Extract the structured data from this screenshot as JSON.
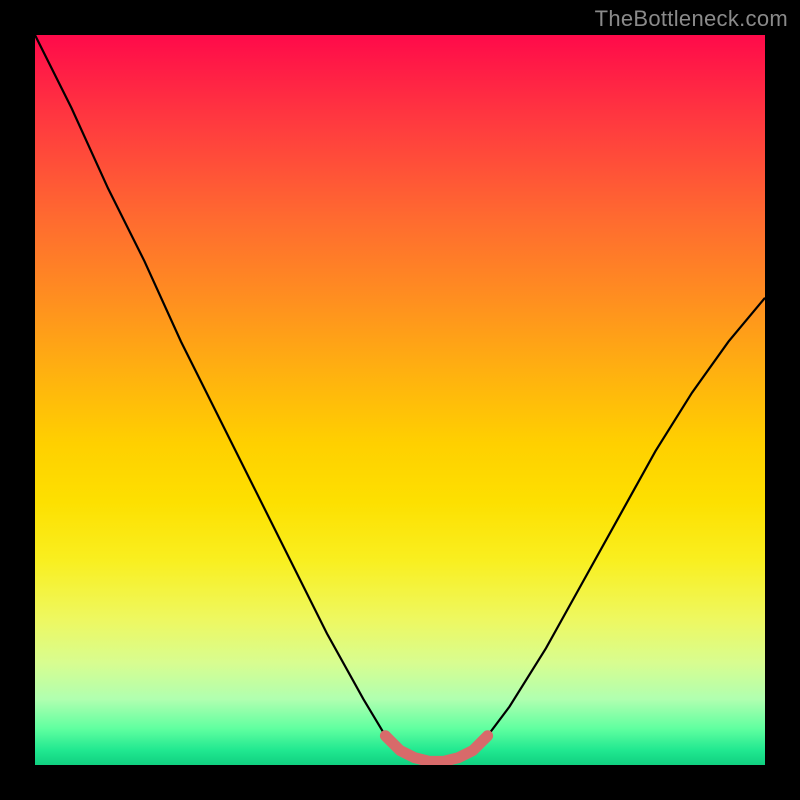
{
  "watermark": "TheBottleneck.com",
  "colors": {
    "frame": "#000000",
    "curve_stroke": "#000000",
    "accent_stroke": "#d86a6a",
    "gradient_top": "#ff0a4a",
    "gradient_bottom": "#10d080"
  },
  "chart_data": {
    "type": "line",
    "title": "",
    "xlabel": "",
    "ylabel": "",
    "xlim": [
      0,
      100
    ],
    "ylim": [
      0,
      100
    ],
    "grid": false,
    "legend": false,
    "annotations": [],
    "x": [
      0,
      5,
      10,
      15,
      20,
      25,
      30,
      35,
      40,
      45,
      48,
      50,
      52,
      54,
      56,
      58,
      60,
      62,
      65,
      70,
      75,
      80,
      85,
      90,
      95,
      100
    ],
    "values": [
      100,
      90,
      79,
      69,
      58,
      48,
      38,
      28,
      18,
      9,
      4,
      2,
      1,
      0.5,
      0.5,
      1,
      2,
      4,
      8,
      16,
      25,
      34,
      43,
      51,
      58,
      64
    ],
    "series": [
      {
        "name": "bottleneck-curve",
        "x": [
          0,
          5,
          10,
          15,
          20,
          25,
          30,
          35,
          40,
          45,
          48,
          50,
          52,
          54,
          56,
          58,
          60,
          62,
          65,
          70,
          75,
          80,
          85,
          90,
          95,
          100
        ],
        "values": [
          100,
          90,
          79,
          69,
          58,
          48,
          38,
          28,
          18,
          9,
          4,
          2,
          1,
          0.5,
          0.5,
          1,
          2,
          4,
          8,
          16,
          25,
          34,
          43,
          51,
          58,
          64
        ]
      },
      {
        "name": "optimal-zone-highlight",
        "x": [
          48,
          50,
          52,
          54,
          56,
          58,
          60,
          62
        ],
        "values": [
          4,
          2,
          1,
          0.5,
          0.5,
          1,
          2,
          4
        ]
      }
    ]
  }
}
